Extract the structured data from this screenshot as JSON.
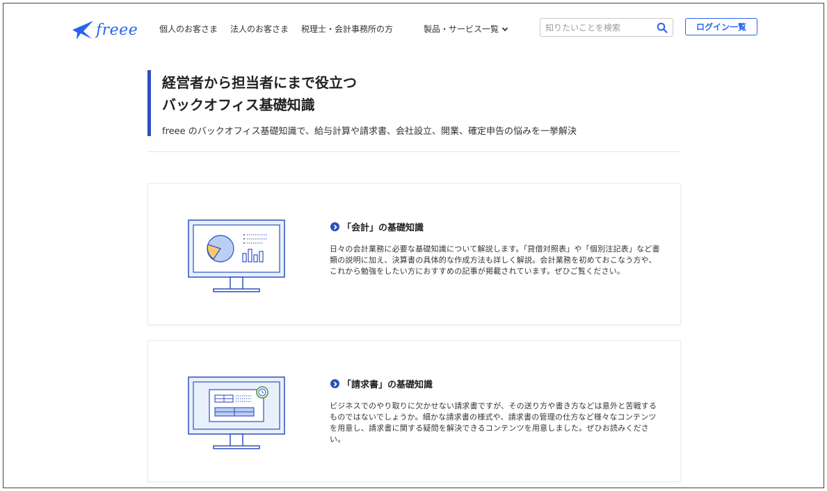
{
  "header": {
    "logo_text": "freee",
    "nav": [
      "個人のお客さま",
      "法人のお客さま",
      "税理士・会計事務所の方"
    ],
    "products_label": "製品・サービス一覧",
    "search_placeholder": "知りたいことを検索",
    "login_label": "ログイン一覧"
  },
  "hero": {
    "title_line1": "経営者から担当者にまで役立つ",
    "title_line2": "バックオフィス基礎知識",
    "subtitle": "freee のバックオフィス基礎知識で、給与計算や請求書、会社設立、開業、確定申告の悩みを一挙解決"
  },
  "cards": [
    {
      "title": "「会計」の基礎知識",
      "description": "日々の会計業務に必要な基礎知識について解説します。「貸借対照表」や「個別注記表」など書類の説明に加え、決算書の具体的な作成方法も詳しく解説。会計業務を初めておこなう方や、これから勉強をしたい方におすすめの記事が掲載されています。ぜひご覧ください。"
    },
    {
      "title": "「請求書」の基礎知識",
      "description": "ビジネスでのやり取りに欠かせない請求書ですが、その送り方や書き方などは意外と苦戦するものではないでしょうか。細かな請求書の様式や、請求書の管理の仕方など様々なコンテンツを用意し、請求書に関する疑問を解決できるコンテンツを用意しました。ぜひお読みください。"
    }
  ],
  "colors": {
    "brand_blue": "#2864f0",
    "accent_navy": "#2d4fbd",
    "illust_light": "#e8f0fb"
  }
}
